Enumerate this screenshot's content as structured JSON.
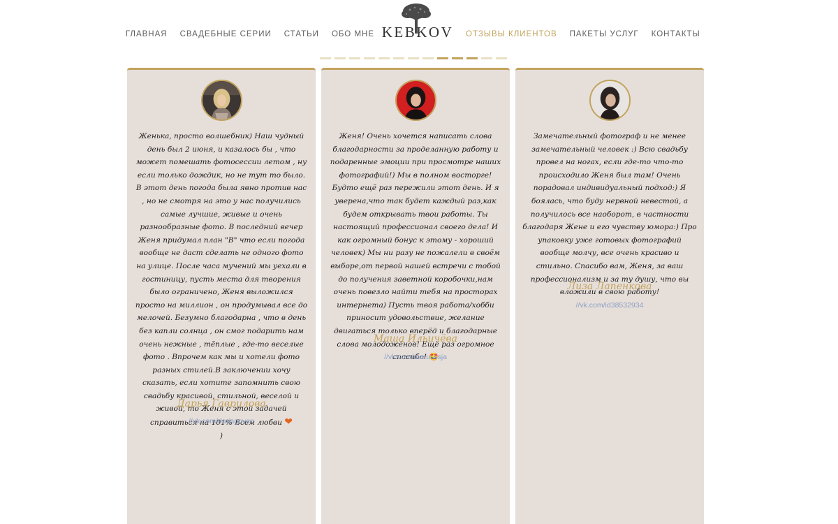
{
  "nav": {
    "left": [
      "ГЛАВНАЯ",
      "СВАДЕБНЫЕ СЕРИИ",
      "СТАТЬИ",
      "ОБО МНЕ"
    ],
    "right": [
      "ОТЗЫВЫ КЛИЕНТОВ",
      "ПАКЕТЫ УСЛУГ",
      "КОНТАКТЫ"
    ],
    "active": "ОТЗЫВЫ КЛИЕНТОВ"
  },
  "logo": {
    "text": "KEBKOV",
    "icon": "tree-icon"
  },
  "slider": {
    "total_dots": 13,
    "active_dots": [
      8,
      9,
      10
    ]
  },
  "colors": {
    "accent": "#c2a35c",
    "card_bg": "#e6ded9",
    "link": "#8da2c6"
  },
  "testimonials": [
    {
      "quote": "Женька, просто волшебник) Наш чудный день был 2 июня, и казалось бы , что может помешать фотосессии летом , ну если только дождик, но не тут то было. В этот день погода была явно против нас , но не смотря на это у нас получились самые лучшие, живые и очень разнообразные фото. В последний вечер Женя придумал план \"В\" что если погода вообще не даст сделать не одного фото на улице. После часа мучений мы уехали в гостиницу, пусть места для творения было ограничено, Женя выложился просто на миллион , он продумывал все до мелочей. Безумно благодарна , что в день без капли солнца , он смог подарить нам очень нежные , тёплые , где-то веселые фото . Впрочем как мы и хотели фото разных стилей.В заключении хочу сказать, если хотите запомнить свою свадьбу красивой, стильной, веселой и живой, то Женя с этой задачей справиться на 101% Всем любви",
      "ending": ")",
      "name": "Дарья Гаврилова",
      "link": "//vk.com/dariagoven"
    },
    {
      "quote": "Женя! Очень хочется написать слова благодарности за проделанную работу и подаренные эмоции при просмотре наших фотографий!) Мы в полном восторге! Будто ещё раз пережили этот день. И я уверена,что так будет каждый раз,как будем открывать твои работы. Ты настоящий профессионал своего дела! И как огромный бонус к этому - хороший человек) Мы ни разу не пожалели в своём выборе,от первой нашей встречи с тобой до получения заветной коробочки,нам очень повезло найти тебя на просторах интернета) Пусть твоя работа/хобби приносит удовольствие, желание двигаться только вперёд и благодарные слова молодожёнов! Ещё раз огромное спасибо!",
      "ending": "",
      "name": "Маша Ильичёва",
      "link": "//vk.com/marusssja"
    },
    {
      "quote": "Замечательный фотограф и не менее замечательный человек :) Всю свадьбу провел на ногах, если где-то что-то происходило Женя был там! Очень порадовал индивидуальный подход:) Я боялась, что буду нервной невестой, а получилось все наоборот, в частности благодаря Жене и его чувству юмора:) Про упаковку уже готовых фотографий вообще молчу, все очень красиво и стильно. Спасибо вам, Женя, за ваш профессионализм и за ту душу, что вы вложили в свою работу!",
      "ending": "",
      "name": "Лиза Лапенкова",
      "link": "//vk.com/id38532934"
    }
  ]
}
